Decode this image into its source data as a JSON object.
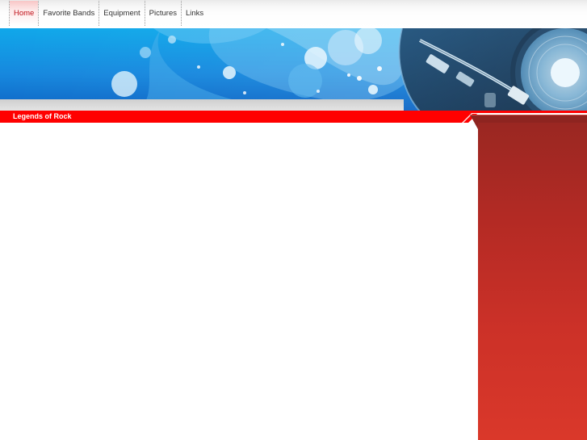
{
  "nav": {
    "items": [
      {
        "label": "Home",
        "active": true
      },
      {
        "label": "Favorite Bands",
        "active": false
      },
      {
        "label": "Equipment",
        "active": false
      },
      {
        "label": "Pictures",
        "active": false
      },
      {
        "label": "Links",
        "active": false
      }
    ]
  },
  "banner": {
    "image": "turntable-icon"
  },
  "section": {
    "title": "Legends of Rock"
  },
  "colors": {
    "accent_red": "#ff0000",
    "active_nav_text": "#c0121b",
    "banner_blue": "#1e88e0",
    "sidebar_red": "#c02e26"
  }
}
